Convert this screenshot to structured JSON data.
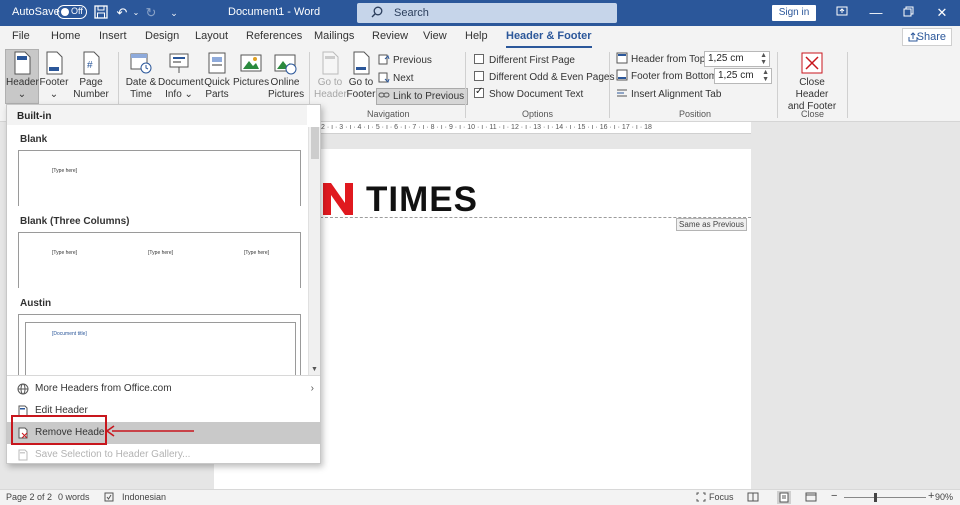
{
  "titlebar": {
    "autosave": "AutoSave",
    "autosave_state": "Off",
    "doc_title": "Document1  -  Word",
    "search_placeholder": "Search",
    "sign_in": "Sign in"
  },
  "tabs": [
    "File",
    "Home",
    "Insert",
    "Design",
    "Layout",
    "References",
    "Mailings",
    "Review",
    "View",
    "Help",
    "Header & Footer"
  ],
  "share": "Share",
  "ribbon": {
    "header_btn": [
      "Header",
      "⌄"
    ],
    "footer_btn": [
      "Footer",
      "⌄"
    ],
    "pagenum_btn": [
      "Page",
      "Number ⌄"
    ],
    "datetime_btn": [
      "Date &",
      "Time"
    ],
    "docinfo_btn": [
      "Document",
      "Info ⌄"
    ],
    "quickparts_btn": [
      "Quick",
      "Parts ⌄"
    ],
    "pictures_btn": [
      "Pictures",
      ""
    ],
    "onlinepics_btn": [
      "Online",
      "Pictures"
    ],
    "goto_header_btn": [
      "Go to",
      "Header"
    ],
    "goto_footer_btn": [
      "Go to",
      "Footer"
    ],
    "previous": "Previous",
    "next": "Next",
    "link_to_previous": "Link to Previous",
    "navigation_label": "Navigation",
    "opt_first_page": "Different First Page",
    "opt_odd_even": "Different Odd & Even Pages",
    "opt_show_doc_text": "Show Document Text",
    "options_label": "Options",
    "header_from_top_label": "Header from Top:",
    "header_from_top_value": "1,25 cm",
    "footer_from_bottom_label": "Footer from Bottom:",
    "footer_from_bottom_value": "1,25 cm",
    "insert_alignment_tab": "Insert Alignment Tab",
    "position_label": "Position",
    "close_btn": [
      "Close Header",
      "and Footer"
    ],
    "close_label": "Close"
  },
  "ruler": "2 · ı · 3 · ı · 4 · ı · 5 · ı · 6 · ı · 7 · ı · 8 · ı · 9 · ı · 10 · ı · 11 · ı · 12 · ı · 13 · ı · 14 · ı · 15 · ı · 16 · ı · 17 · ı · 18",
  "document": {
    "logo_text": "TIMES",
    "same_as_previous": "Same as Previous"
  },
  "dropdown": {
    "section": "Built-in",
    "items": [
      {
        "title": "Blank",
        "placeholders": [
          "[Type here]"
        ]
      },
      {
        "title": "Blank (Three Columns)",
        "placeholders": [
          "[Type here]",
          "[Type here]",
          "[Type here]"
        ]
      },
      {
        "title": "Austin",
        "placeholders": [
          "[Document title]"
        ]
      }
    ],
    "menu": {
      "more_headers": "More Headers from Office.com",
      "edit_header": "Edit Header",
      "remove_header": "Remove Header",
      "save_selection": "Save Selection to Header Gallery..."
    }
  },
  "status": {
    "page": "Page 2 of 2",
    "words": "0 words",
    "language": "Indonesian",
    "focus": "Focus",
    "zoom": "90%"
  },
  "colors": {
    "accent": "#2b579a",
    "highlight_red": "#c8161d",
    "logo_red": "#e0191f"
  }
}
